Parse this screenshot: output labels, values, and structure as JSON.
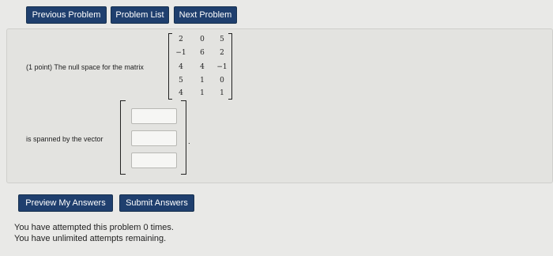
{
  "nav": {
    "previous_label": "Previous Problem",
    "list_label": "Problem List",
    "next_label": "Next Problem"
  },
  "problem": {
    "statement": "(1 point) The null space for the matrix",
    "spanned_label": "is spanned by the vector",
    "matrix": [
      [
        "2",
        "0",
        "5"
      ],
      [
        "−1",
        "6",
        "2"
      ],
      [
        "4",
        "4",
        "−1"
      ],
      [
        "5",
        "1",
        "0"
      ],
      [
        "4",
        "1",
        "1"
      ]
    ],
    "vector_values": [
      "",
      "",
      ""
    ],
    "trailing_period": "."
  },
  "actions": {
    "preview_label": "Preview My Answers",
    "submit_label": "Submit Answers"
  },
  "status": {
    "attempts_line": "You have attempted this problem 0 times.",
    "remaining_line": "You have unlimited attempts remaining."
  }
}
